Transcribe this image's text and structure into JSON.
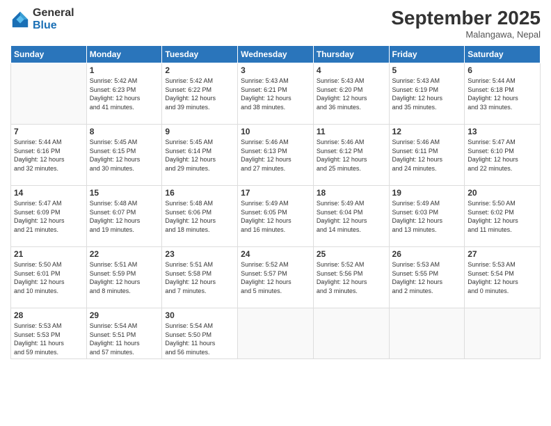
{
  "logo": {
    "general": "General",
    "blue": "Blue"
  },
  "header": {
    "month": "September 2025",
    "location": "Malangawa, Nepal"
  },
  "weekdays": [
    "Sunday",
    "Monday",
    "Tuesday",
    "Wednesday",
    "Thursday",
    "Friday",
    "Saturday"
  ],
  "weeks": [
    [
      {
        "day": "",
        "info": ""
      },
      {
        "day": "1",
        "info": "Sunrise: 5:42 AM\nSunset: 6:23 PM\nDaylight: 12 hours\nand 41 minutes."
      },
      {
        "day": "2",
        "info": "Sunrise: 5:42 AM\nSunset: 6:22 PM\nDaylight: 12 hours\nand 39 minutes."
      },
      {
        "day": "3",
        "info": "Sunrise: 5:43 AM\nSunset: 6:21 PM\nDaylight: 12 hours\nand 38 minutes."
      },
      {
        "day": "4",
        "info": "Sunrise: 5:43 AM\nSunset: 6:20 PM\nDaylight: 12 hours\nand 36 minutes."
      },
      {
        "day": "5",
        "info": "Sunrise: 5:43 AM\nSunset: 6:19 PM\nDaylight: 12 hours\nand 35 minutes."
      },
      {
        "day": "6",
        "info": "Sunrise: 5:44 AM\nSunset: 6:18 PM\nDaylight: 12 hours\nand 33 minutes."
      }
    ],
    [
      {
        "day": "7",
        "info": "Sunrise: 5:44 AM\nSunset: 6:16 PM\nDaylight: 12 hours\nand 32 minutes."
      },
      {
        "day": "8",
        "info": "Sunrise: 5:45 AM\nSunset: 6:15 PM\nDaylight: 12 hours\nand 30 minutes."
      },
      {
        "day": "9",
        "info": "Sunrise: 5:45 AM\nSunset: 6:14 PM\nDaylight: 12 hours\nand 29 minutes."
      },
      {
        "day": "10",
        "info": "Sunrise: 5:46 AM\nSunset: 6:13 PM\nDaylight: 12 hours\nand 27 minutes."
      },
      {
        "day": "11",
        "info": "Sunrise: 5:46 AM\nSunset: 6:12 PM\nDaylight: 12 hours\nand 25 minutes."
      },
      {
        "day": "12",
        "info": "Sunrise: 5:46 AM\nSunset: 6:11 PM\nDaylight: 12 hours\nand 24 minutes."
      },
      {
        "day": "13",
        "info": "Sunrise: 5:47 AM\nSunset: 6:10 PM\nDaylight: 12 hours\nand 22 minutes."
      }
    ],
    [
      {
        "day": "14",
        "info": "Sunrise: 5:47 AM\nSunset: 6:09 PM\nDaylight: 12 hours\nand 21 minutes."
      },
      {
        "day": "15",
        "info": "Sunrise: 5:48 AM\nSunset: 6:07 PM\nDaylight: 12 hours\nand 19 minutes."
      },
      {
        "day": "16",
        "info": "Sunrise: 5:48 AM\nSunset: 6:06 PM\nDaylight: 12 hours\nand 18 minutes."
      },
      {
        "day": "17",
        "info": "Sunrise: 5:49 AM\nSunset: 6:05 PM\nDaylight: 12 hours\nand 16 minutes."
      },
      {
        "day": "18",
        "info": "Sunrise: 5:49 AM\nSunset: 6:04 PM\nDaylight: 12 hours\nand 14 minutes."
      },
      {
        "day": "19",
        "info": "Sunrise: 5:49 AM\nSunset: 6:03 PM\nDaylight: 12 hours\nand 13 minutes."
      },
      {
        "day": "20",
        "info": "Sunrise: 5:50 AM\nSunset: 6:02 PM\nDaylight: 12 hours\nand 11 minutes."
      }
    ],
    [
      {
        "day": "21",
        "info": "Sunrise: 5:50 AM\nSunset: 6:01 PM\nDaylight: 12 hours\nand 10 minutes."
      },
      {
        "day": "22",
        "info": "Sunrise: 5:51 AM\nSunset: 5:59 PM\nDaylight: 12 hours\nand 8 minutes."
      },
      {
        "day": "23",
        "info": "Sunrise: 5:51 AM\nSunset: 5:58 PM\nDaylight: 12 hours\nand 7 minutes."
      },
      {
        "day": "24",
        "info": "Sunrise: 5:52 AM\nSunset: 5:57 PM\nDaylight: 12 hours\nand 5 minutes."
      },
      {
        "day": "25",
        "info": "Sunrise: 5:52 AM\nSunset: 5:56 PM\nDaylight: 12 hours\nand 3 minutes."
      },
      {
        "day": "26",
        "info": "Sunrise: 5:53 AM\nSunset: 5:55 PM\nDaylight: 12 hours\nand 2 minutes."
      },
      {
        "day": "27",
        "info": "Sunrise: 5:53 AM\nSunset: 5:54 PM\nDaylight: 12 hours\nand 0 minutes."
      }
    ],
    [
      {
        "day": "28",
        "info": "Sunrise: 5:53 AM\nSunset: 5:53 PM\nDaylight: 11 hours\nand 59 minutes."
      },
      {
        "day": "29",
        "info": "Sunrise: 5:54 AM\nSunset: 5:51 PM\nDaylight: 11 hours\nand 57 minutes."
      },
      {
        "day": "30",
        "info": "Sunrise: 5:54 AM\nSunset: 5:50 PM\nDaylight: 11 hours\nand 56 minutes."
      },
      {
        "day": "",
        "info": ""
      },
      {
        "day": "",
        "info": ""
      },
      {
        "day": "",
        "info": ""
      },
      {
        "day": "",
        "info": ""
      }
    ]
  ]
}
